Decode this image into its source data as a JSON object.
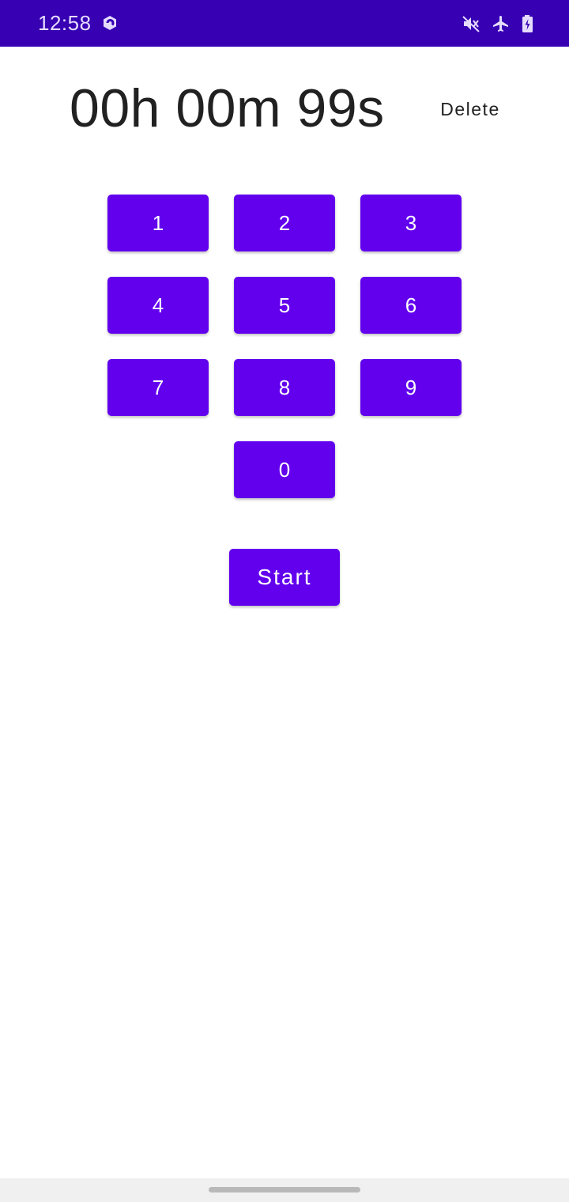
{
  "status_bar": {
    "time": "12:58",
    "background_color": "#3700b3",
    "icons": [
      "app-notification-icon",
      "vibrate-icon",
      "airplane-mode-icon",
      "battery-charging-icon"
    ]
  },
  "timer": {
    "display": "00h 00m 99s",
    "delete_label": "Delete"
  },
  "keypad": {
    "accent_color": "#6200ee",
    "keys": [
      "1",
      "2",
      "3",
      "4",
      "5",
      "6",
      "7",
      "8",
      "9",
      "0"
    ]
  },
  "start_label": "Start"
}
